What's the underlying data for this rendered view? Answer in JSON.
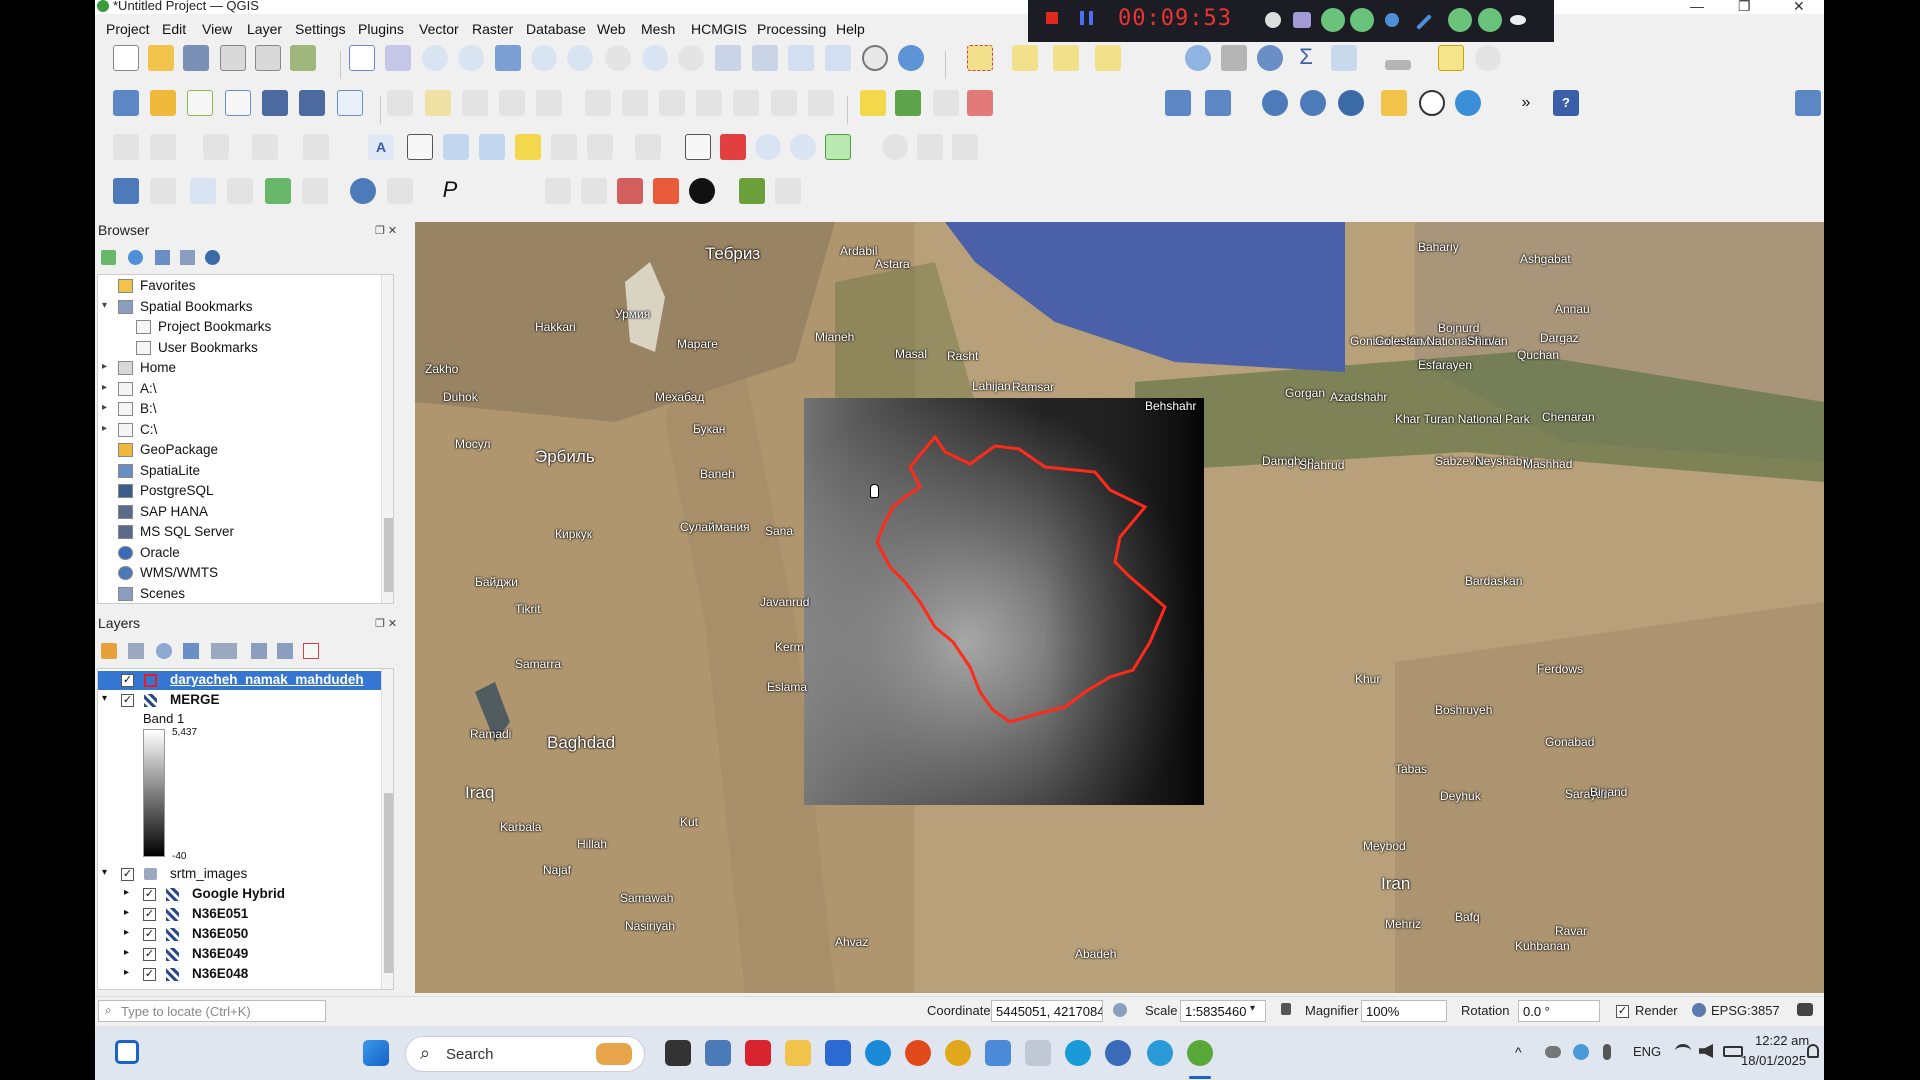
{
  "window": {
    "title": "*Untitled Project — QGIS"
  },
  "recorder": {
    "timer": "00:09:53"
  },
  "menu": [
    "Project",
    "Edit",
    "View",
    "Layer",
    "Settings",
    "Plugins",
    "Vector",
    "Raster",
    "Database",
    "Web",
    "Mesh",
    "HCMGIS",
    "Processing",
    "Help"
  ],
  "browser": {
    "title": "Browser",
    "items": [
      {
        "label": "Favorites",
        "icon": "star-icon",
        "level": 0,
        "arrow": ""
      },
      {
        "label": "Spatial Bookmarks",
        "icon": "bookmark-icon",
        "level": 0,
        "arrow": "▾"
      },
      {
        "label": "Project Bookmarks",
        "icon": "folder-icon",
        "level": 1,
        "arrow": ""
      },
      {
        "label": "User Bookmarks",
        "icon": "folder-icon",
        "level": 1,
        "arrow": ""
      },
      {
        "label": "Home",
        "icon": "home-icon",
        "level": 0,
        "arrow": "▸"
      },
      {
        "label": "A:\\",
        "icon": "folder-icon",
        "level": 0,
        "arrow": "▸"
      },
      {
        "label": "B:\\",
        "icon": "folder-icon",
        "level": 0,
        "arrow": "▸"
      },
      {
        "label": "C:\\",
        "icon": "folder-icon",
        "level": 0,
        "arrow": "▸"
      },
      {
        "label": "GeoPackage",
        "icon": "geopackage-icon",
        "level": 0,
        "arrow": ""
      },
      {
        "label": "SpatiaLite",
        "icon": "spatialite-icon",
        "level": 0,
        "arrow": ""
      },
      {
        "label": "PostgreSQL",
        "icon": "postgresql-icon",
        "level": 0,
        "arrow": ""
      },
      {
        "label": "SAP HANA",
        "icon": "database-icon",
        "level": 0,
        "arrow": ""
      },
      {
        "label": "MS SQL Server",
        "icon": "mssql-icon",
        "level": 0,
        "arrow": ""
      },
      {
        "label": "Oracle",
        "icon": "oracle-icon",
        "level": 0,
        "arrow": ""
      },
      {
        "label": "WMS/WMTS",
        "icon": "globe-icon",
        "level": 0,
        "arrow": ""
      },
      {
        "label": "Scenes",
        "icon": "scenes-icon",
        "level": 0,
        "arrow": ""
      }
    ]
  },
  "layers": {
    "title": "Layers",
    "items": [
      {
        "label": "daryacheh_namak_mahdudeh",
        "checked": true,
        "selected": true,
        "bold": true
      },
      {
        "label": "MERGE",
        "checked": true,
        "bold": true
      },
      {
        "label": "Band 1"
      },
      {
        "label": "srtm_images",
        "checked": true
      },
      {
        "label": "Google Hybrid",
        "checked": true,
        "bold": true
      },
      {
        "label": "N36E051",
        "checked": true,
        "bold": true
      },
      {
        "label": "N36E050",
        "checked": true,
        "bold": true
      },
      {
        "label": "N36E049",
        "checked": true,
        "bold": true
      },
      {
        "label": "N36E048",
        "checked": true,
        "bold": true
      }
    ],
    "legend_max": "5,437",
    "legend_min": "-40"
  },
  "map_labels": [
    "Тебриз",
    "Ardabil",
    "Astara",
    "Урмия",
    "Hakkari",
    "Мараге",
    "Mianeh",
    "Rasht",
    "Masal",
    "Lahijan",
    "Ramsar",
    "Zakho",
    "Duhok",
    "Мехабад",
    "Букан",
    "Мосул",
    "Эрбиль",
    "Baneh",
    "Сулаймания",
    "Киркук",
    "Байджи",
    "Tikrit",
    "Samarra",
    "Ramadi",
    "Baghdad",
    "Iraq",
    "Karbala",
    "Hillah",
    "Najaf",
    "Kut",
    "Samawah",
    "Nasiriyah",
    "Ahvaz",
    "Abadeh",
    "Behshahr",
    "Gorgan",
    "Azadshahr",
    "Gonbad-e Kavus",
    "Golestan National Park",
    "Khar Turan National Park",
    "Damghan",
    "Shahrud",
    "Sabzevar",
    "Neyshabur",
    "Mashhad",
    "Ashgabat",
    "Bojnurd",
    "Shirvan",
    "Quchan",
    "Dargaz",
    "Esfarayen",
    "Chenaran",
    "Bardaskan",
    "Khur",
    "Ferdows",
    "Boshruyeh",
    "Tabas",
    "Gonabad",
    "Deyhuk",
    "Sarayan",
    "Birjand",
    "Meybod",
    "Iran",
    "Mehriz",
    "Bafq",
    "Kuhbanan",
    "Ravar",
    "Bahariy",
    "Annau",
    "Sana",
    "Kerm",
    "Eslama",
    "Javanrud"
  ],
  "status": {
    "locate_placeholder": "Type to locate (Ctrl+K)",
    "coordinate_label": "Coordinate",
    "coordinate": "5445051, 4217084",
    "scale_label": "Scale",
    "scale": "1:5835460",
    "magnifier_label": "Magnifier",
    "magnifier": "100%",
    "rotation_label": "Rotation",
    "rotation": "0.0 °",
    "render_label": "Render",
    "crs": "EPSG:3857"
  },
  "taskbar": {
    "search": "Search",
    "lang": "ENG",
    "time": "12:22 am",
    "date": "18/01/2025"
  }
}
